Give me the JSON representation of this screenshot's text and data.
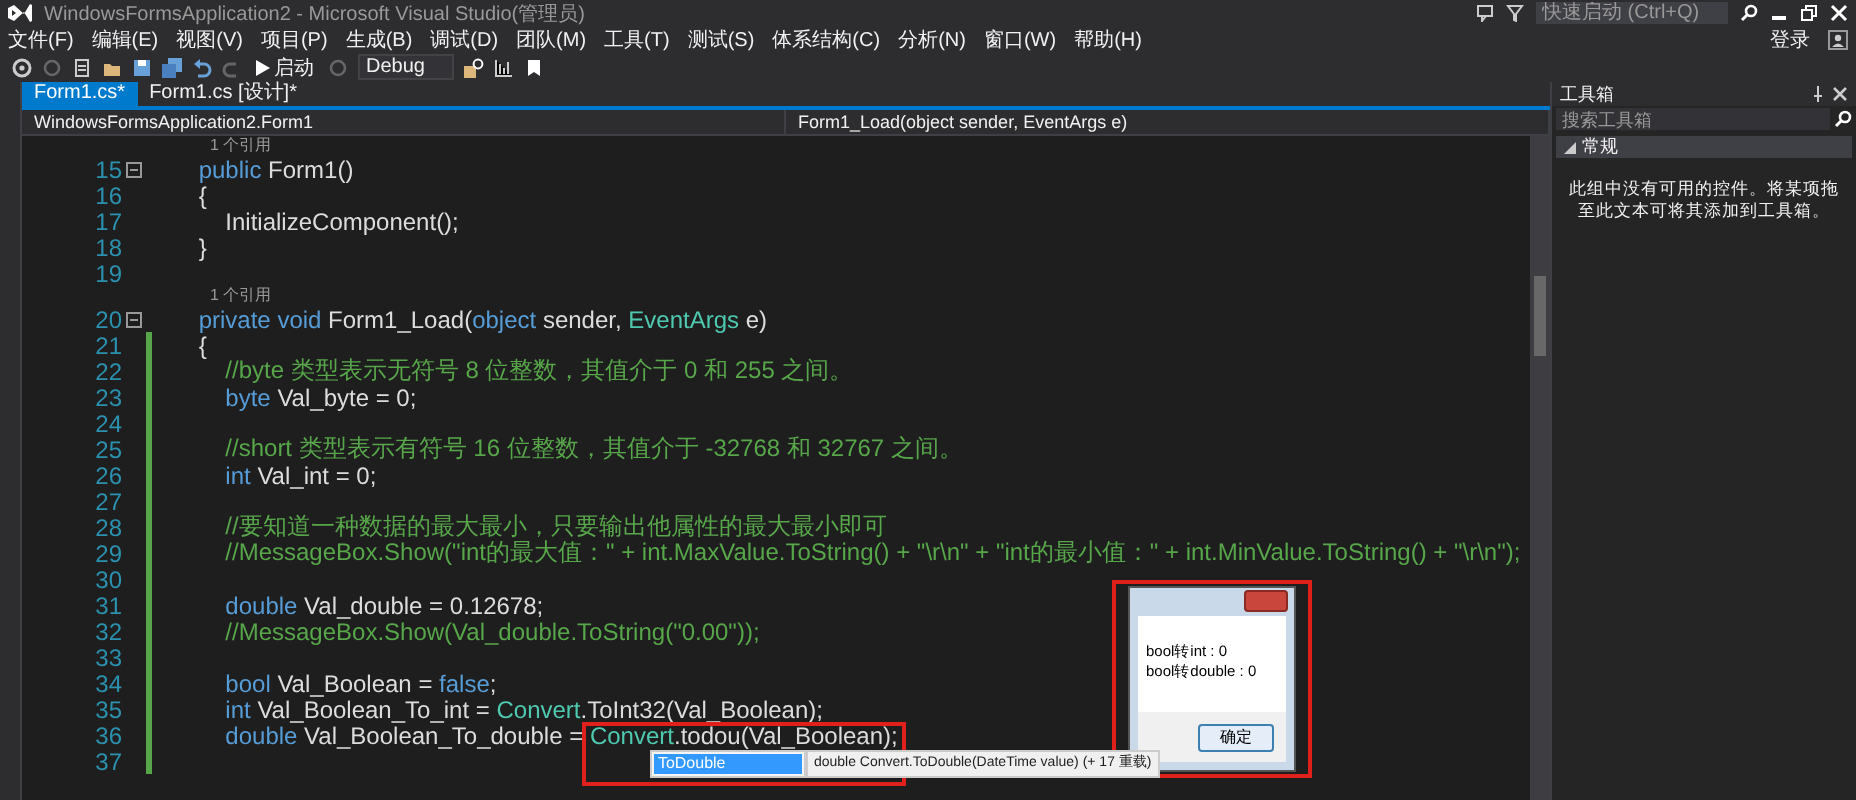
{
  "window": {
    "title": "WindowsFormsApplication2 - Microsoft Visual Studio(管理员)",
    "quick_launch": {
      "placeholder": "快速启动 (Ctrl+Q)"
    },
    "sign_in": "登录"
  },
  "menu": [
    "文件(F)",
    "编辑(E)",
    "视图(V)",
    "项目(P)",
    "生成(B)",
    "调试(D)",
    "团队(M)",
    "工具(T)",
    "测试(S)",
    "体系结构(C)",
    "分析(N)",
    "窗口(W)",
    "帮助(H)"
  ],
  "toolbar": {
    "start_label": "启动",
    "configuration": "Debug"
  },
  "tabs": [
    {
      "label": "Form1.cs*",
      "selected": true
    },
    {
      "label": "Form1.cs [设计]*",
      "selected": false
    }
  ],
  "navigation": {
    "class": "WindowsFormsApplication2.Form1",
    "member": "Form1_Load(object sender, EventArgs e)"
  },
  "code_lines": [
    {
      "kind": "lens",
      "text": "1 个引用"
    },
    {
      "kind": "code",
      "number": "15",
      "foldable": true,
      "changed": false,
      "segments": [
        {
          "kind": "kw",
          "text": "    public"
        },
        {
          "kind": "text",
          "text": " Form1()"
        }
      ]
    },
    {
      "kind": "code",
      "number": "16",
      "foldable": false,
      "changed": false,
      "segments": [
        {
          "kind": "text",
          "text": "    {"
        }
      ]
    },
    {
      "kind": "code",
      "number": "17",
      "foldable": false,
      "changed": false,
      "segments": [
        {
          "kind": "text",
          "text": "        InitializeComponent();"
        }
      ]
    },
    {
      "kind": "code",
      "number": "18",
      "foldable": false,
      "changed": false,
      "segments": [
        {
          "kind": "text",
          "text": "    }"
        }
      ]
    },
    {
      "kind": "code",
      "number": "19",
      "foldable": false,
      "changed": false
    },
    {
      "kind": "lens",
      "text": "1 个引用"
    },
    {
      "kind": "code",
      "number": "20",
      "foldable": true,
      "changed": false,
      "segments": [
        {
          "kind": "kw",
          "text": "    private void"
        },
        {
          "kind": "text",
          "text": " Form1_Load("
        },
        {
          "kind": "kw",
          "text": "object"
        },
        {
          "kind": "text",
          "text": " sender, "
        },
        {
          "kind": "type",
          "text": "EventArgs"
        },
        {
          "kind": "text",
          "text": " e)"
        }
      ]
    },
    {
      "kind": "code",
      "number": "21",
      "foldable": false,
      "changed": true,
      "segments": [
        {
          "kind": "text",
          "text": "    {"
        }
      ]
    },
    {
      "kind": "code",
      "number": "22",
      "foldable": false,
      "changed": true,
      "segments": [
        {
          "kind": "comment",
          "text": "        //byte 类型表示无符号 8 位整数，其值介于 0 和 255 之间。"
        }
      ]
    },
    {
      "kind": "code",
      "number": "23",
      "foldable": false,
      "changed": true,
      "segments": [
        {
          "kind": "kw",
          "text": "        byte"
        },
        {
          "kind": "text",
          "text": " Val_byte = 0;"
        }
      ]
    },
    {
      "kind": "code",
      "number": "24",
      "foldable": false,
      "changed": true
    },
    {
      "kind": "code",
      "number": "25",
      "foldable": false,
      "changed": true,
      "segments": [
        {
          "kind": "comment",
          "text": "        //short 类型表示有符号 16 位整数，其值介于 -32768 和 32767 之间。"
        }
      ]
    },
    {
      "kind": "code",
      "number": "26",
      "foldable": false,
      "changed": true,
      "segments": [
        {
          "kind": "kw",
          "text": "        int"
        },
        {
          "kind": "text",
          "text": " Val_int = 0;"
        }
      ]
    },
    {
      "kind": "code",
      "number": "27",
      "foldable": false,
      "changed": true
    },
    {
      "kind": "code",
      "number": "28",
      "foldable": false,
      "changed": true,
      "segments": [
        {
          "kind": "comment",
          "text": "        //要知道一种数据的最大最小，只要输出他属性的最大最小即可"
        }
      ]
    },
    {
      "kind": "code",
      "number": "29",
      "foldable": false,
      "changed": true,
      "segments": [
        {
          "kind": "comment",
          "text": "        //MessageBox.Show(\"int的最大值：\" + int.MaxValue.ToString() + \"\\r\\n\" + \"int的最小值：\" + int.MinValue.ToString() + \"\\r\\n\");"
        }
      ]
    },
    {
      "kind": "code",
      "number": "30",
      "foldable": false,
      "changed": true
    },
    {
      "kind": "code",
      "number": "31",
      "foldable": false,
      "changed": true,
      "segments": [
        {
          "kind": "kw",
          "text": "        double"
        },
        {
          "kind": "text",
          "text": " Val_double = 0.12678;"
        }
      ]
    },
    {
      "kind": "code",
      "number": "32",
      "foldable": false,
      "changed": true,
      "segments": [
        {
          "kind": "comment",
          "text": "        //MessageBox.Show(Val_double.ToString(\"0.00\"));"
        }
      ]
    },
    {
      "kind": "code",
      "number": "33",
      "foldable": false,
      "changed": true
    },
    {
      "kind": "code",
      "number": "34",
      "foldable": false,
      "changed": true,
      "segments": [
        {
          "kind": "kw",
          "text": "        bool"
        },
        {
          "kind": "text",
          "text": " Val_Boolean = "
        },
        {
          "kind": "kw",
          "text": "false"
        },
        {
          "kind": "text",
          "text": ";"
        }
      ]
    },
    {
      "kind": "code",
      "number": "35",
      "foldable": false,
      "changed": true,
      "segments": [
        {
          "kind": "kw",
          "text": "        int"
        },
        {
          "kind": "text",
          "text": " Val_Boolean_To_int = "
        },
        {
          "kind": "type",
          "text": "Convert"
        },
        {
          "kind": "text",
          "text": ".ToInt32(Val_Boolean);"
        }
      ]
    },
    {
      "kind": "code",
      "number": "36",
      "foldable": false,
      "changed": true,
      "segments": [
        {
          "kind": "kw",
          "text": "        double"
        },
        {
          "kind": "text",
          "text": " Val_Boolean_To_double = "
        }
      ],
      "boxed_segments": [
        {
          "kind": "type",
          "text": "Convert"
        },
        {
          "kind": "text",
          "text": ".todou(Val_Boolean);"
        }
      ],
      "autocomplete": {
        "items": [
          {
            "label": "ToDouble",
            "selected": true
          }
        ],
        "tooltip": "double Convert.ToDouble(DateTime value) (+ 17 重载)"
      }
    },
    {
      "kind": "code",
      "number": "37",
      "foldable": false,
      "changed": true
    }
  ],
  "dialog": {
    "lines": [
      "bool转int : 0",
      "bool转double : 0"
    ],
    "button": "确定"
  },
  "toolbox": {
    "title": "工具箱",
    "search": {
      "placeholder": "搜索工具箱"
    },
    "group": {
      "label": "常规",
      "expanded": true
    },
    "message": "此组中没有可用的控件。将某项拖至此文本可将其添加到工具箱。"
  }
}
